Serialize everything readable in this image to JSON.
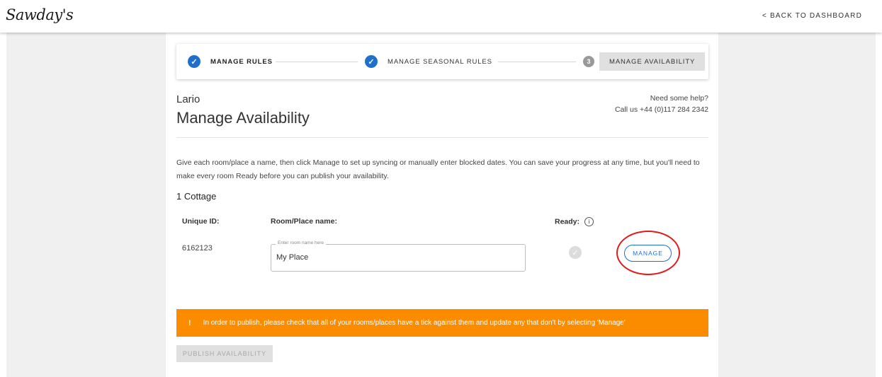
{
  "header": {
    "logo_text": "Sawday's",
    "back_label": "< BACK TO DASHBOARD"
  },
  "stepper": {
    "steps": [
      {
        "label": "MANAGE RULES",
        "state": "complete"
      },
      {
        "label": "MANAGE SEASONAL RULES",
        "state": "complete"
      },
      {
        "number": "3",
        "label": "MANAGE AVAILABILITY",
        "state": "active"
      }
    ]
  },
  "page": {
    "property_name": "Lario",
    "title": "Manage Availability",
    "help_line1": "Need some help?",
    "help_line2": "Call us +44 (0)117 284 2342",
    "intro": "Give each room/place a name, then click Manage to set up syncing or manually enter blocked dates. You can save your progress at any time, but you'll need to make every room Ready before you can publish your availability."
  },
  "rooms_section": {
    "title": "1 Cottage",
    "columns": {
      "unique_id": "Unique ID:",
      "room_name": "Room/Place name:",
      "ready": "Ready:"
    },
    "rows": [
      {
        "unique_id": "6162123",
        "name_placeholder": "Enter room name here",
        "name_value": "My Place",
        "ready": false,
        "manage_label": "MANAGE"
      }
    ]
  },
  "alert": {
    "icon": "!",
    "text": "In order to publish, please check that all of your rooms/places have a tick against them and update any that don't by selecting 'Manage'",
    "color": "#fb8c00"
  },
  "publish_button": {
    "label": "PUBLISH AVAILABILITY",
    "disabled": true
  },
  "colors": {
    "accent": "#1e6fce",
    "annotation": "#e01b1b"
  }
}
